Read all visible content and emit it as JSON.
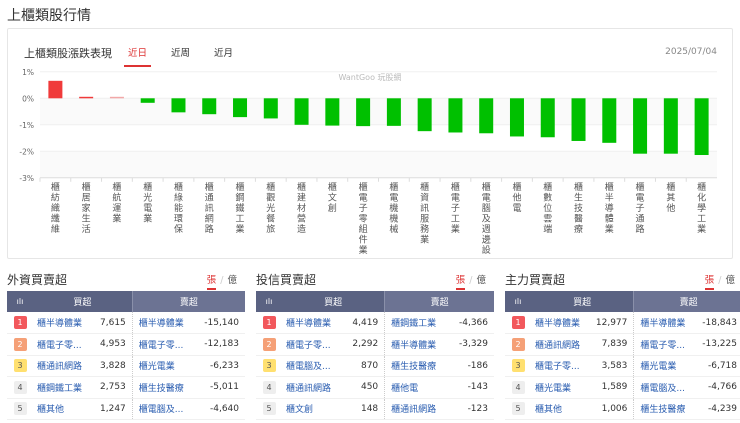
{
  "page_title": "上櫃類股行情",
  "chart_card": {
    "title": "上櫃類股漲跌表現",
    "tabs": [
      {
        "label": "近日",
        "active": true
      },
      {
        "label": "近周",
        "active": false
      },
      {
        "label": "近月",
        "active": false
      }
    ],
    "date": "2025/07/04",
    "watermark": "WantGoo 玩股網"
  },
  "chart_data": {
    "type": "bar",
    "categories": [
      "櫃紡織纖維",
      "櫃居家生活",
      "櫃航運業",
      "櫃光電業",
      "櫃綠能環保",
      "櫃通訊網路",
      "櫃鋼鐵工業",
      "櫃觀光餐旅",
      "櫃建材營造",
      "櫃文創",
      "櫃電子零組件業",
      "櫃電機機械",
      "櫃資訊服務業",
      "櫃電子工業",
      "櫃電腦及週邊設",
      "櫃他電",
      "櫃數位雲端",
      "櫃生技醫療",
      "櫃半導體業",
      "櫃電子通路",
      "櫃其他",
      "櫃化學工業"
    ],
    "values": [
      0.66,
      0.04,
      0.02,
      -0.17,
      -0.53,
      -0.6,
      -0.71,
      -0.76,
      -1.0,
      -1.03,
      -1.05,
      -1.04,
      -1.24,
      -1.29,
      -1.32,
      -1.44,
      -1.47,
      -1.61,
      -1.68,
      -2.09,
      -2.09,
      -2.14
    ],
    "unit": "%",
    "ylim": [
      -3,
      1
    ],
    "yticks": [
      "1%",
      "0%",
      "-1%",
      "-2%",
      "-3%"
    ],
    "colors": {
      "up": "#f03a3a",
      "up_light": "#f2a8a8",
      "down": "#00c000"
    },
    "grid": true
  },
  "sections": [
    {
      "title": "外資買賣超",
      "unit_on": "張",
      "unit_off": "億",
      "col_buy": "買超",
      "col_sell": "賣超",
      "rows": [
        [
          "1",
          "櫃半導體業",
          "7,615",
          "櫃半導體業",
          "-15,140"
        ],
        [
          "2",
          "櫃電子零...",
          "4,953",
          "櫃電子零...",
          "-12,183"
        ],
        [
          "3",
          "櫃通訊網路",
          "3,828",
          "櫃光電業",
          "-6,233"
        ],
        [
          "4",
          "櫃鋼鐵工業",
          "2,753",
          "櫃生技醫療",
          "-5,011"
        ],
        [
          "5",
          "櫃其他",
          "1,247",
          "櫃電腦及...",
          "-4,640"
        ]
      ]
    },
    {
      "title": "投信買賣超",
      "unit_on": "張",
      "unit_off": "億",
      "col_buy": "買超",
      "col_sell": "賣超",
      "rows": [
        [
          "1",
          "櫃半導體業",
          "4,419",
          "櫃鋼鐵工業",
          "-4,366"
        ],
        [
          "2",
          "櫃電子零...",
          "2,292",
          "櫃半導體業",
          "-3,329"
        ],
        [
          "3",
          "櫃電腦及...",
          "870",
          "櫃生技醫療",
          "-186"
        ],
        [
          "4",
          "櫃通訊網路",
          "450",
          "櫃他電",
          "-143"
        ],
        [
          "5",
          "櫃文創",
          "148",
          "櫃通訊網路",
          "-123"
        ]
      ]
    },
    {
      "title": "主力買賣超",
      "unit_on": "張",
      "unit_off": "億",
      "col_buy": "買超",
      "col_sell": "賣超",
      "rows": [
        [
          "1",
          "櫃半導體業",
          "12,977",
          "櫃半導體業",
          "-18,843"
        ],
        [
          "2",
          "櫃通訊網路",
          "7,839",
          "櫃電子零...",
          "-13,225"
        ],
        [
          "3",
          "櫃電子零...",
          "3,583",
          "櫃光電業",
          "-6,718"
        ],
        [
          "4",
          "櫃光電業",
          "1,589",
          "櫃電腦及...",
          "-4,766"
        ],
        [
          "5",
          "櫃其他",
          "1,006",
          "櫃生技醫療",
          "-4,239"
        ]
      ]
    }
  ]
}
